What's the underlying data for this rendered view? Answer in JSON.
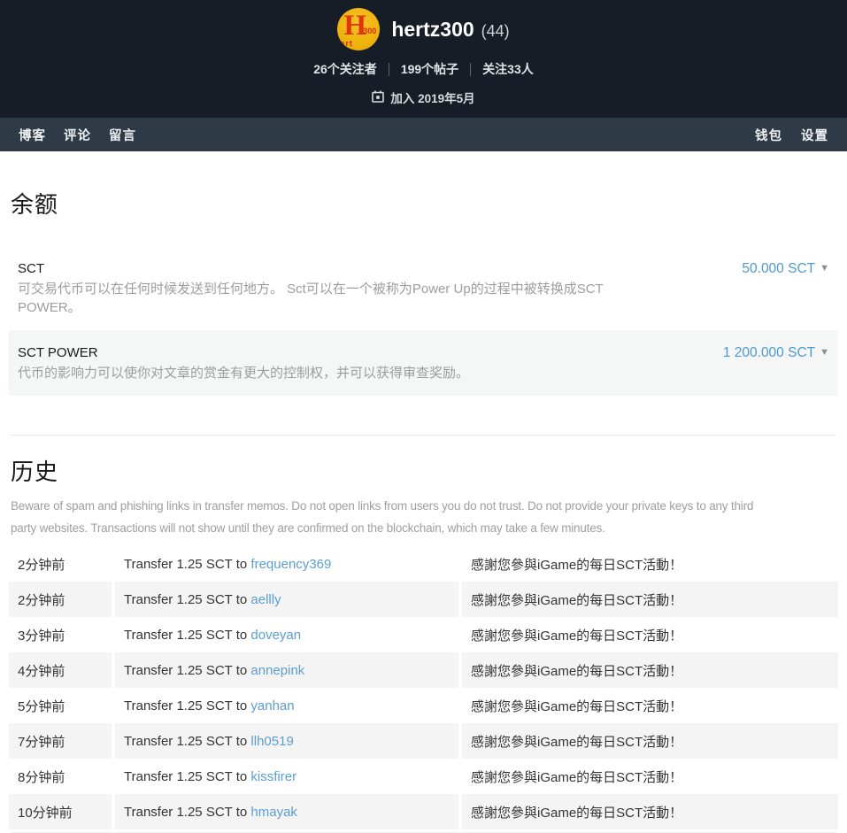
{
  "profile": {
    "username": "hertz300",
    "reputation": "(44)",
    "avatar": {
      "letter": "H",
      "number": "300",
      "sub": "ert"
    },
    "stats": [
      {
        "label": "26个关注者"
      },
      {
        "label": "199个帖子"
      },
      {
        "label": "关注33人"
      }
    ],
    "joined": "加入 2019年5月"
  },
  "nav": {
    "left": [
      {
        "label": "博客"
      },
      {
        "label": "评论"
      },
      {
        "label": "留言"
      }
    ],
    "right": [
      {
        "label": "钱包"
      },
      {
        "label": "设置"
      }
    ]
  },
  "balance": {
    "title": "余额",
    "rows": [
      {
        "label": "SCT",
        "description": "可交易代币可以在任何时候发送到任何地方。 Sct可以在一个被称为Power Up的过程中被转换成SCT POWER。",
        "amount": "50.000 SCT"
      },
      {
        "label": "SCT POWER",
        "description": "代币的影响力可以使你对文章的赏金有更大的控制权，并可以获得审查奖励。",
        "amount": "1 200.000 SCT"
      }
    ]
  },
  "history": {
    "title": "历史",
    "warning": "Beware of spam and phishing links in transfer memos. Do not open links from users you do not trust. Do not provide your private keys to any third party websites. Transactions will not show until they are confirmed on the blockchain, which may take a few minutes.",
    "transactions": [
      {
        "time": "2分钟前",
        "action": "Transfer 1.25 SCT to ",
        "recipient": "frequency369",
        "memo": "感謝您參與iGame的每日SCT活動！"
      },
      {
        "time": "2分钟前",
        "action": "Transfer 1.25 SCT to ",
        "recipient": "aellly",
        "memo": "感謝您參與iGame的每日SCT活動！"
      },
      {
        "time": "3分钟前",
        "action": "Transfer 1.25 SCT to ",
        "recipient": "doveyan",
        "memo": "感謝您參與iGame的每日SCT活動！"
      },
      {
        "time": "4分钟前",
        "action": "Transfer 1.25 SCT to ",
        "recipient": "annepink",
        "memo": "感謝您參與iGame的每日SCT活動！"
      },
      {
        "time": "5分钟前",
        "action": "Transfer 1.25 SCT to ",
        "recipient": "yanhan",
        "memo": "感謝您參與iGame的每日SCT活動！"
      },
      {
        "time": "7分钟前",
        "action": "Transfer 1.25 SCT to ",
        "recipient": "llh0519",
        "memo": "感謝您參與iGame的每日SCT活動！"
      },
      {
        "time": "8分钟前",
        "action": "Transfer 1.25 SCT to ",
        "recipient": "kissfirer",
        "memo": "感謝您參與iGame的每日SCT活動！"
      },
      {
        "time": "10分钟前",
        "action": "Transfer 1.25 SCT to ",
        "recipient": "hmayak",
        "memo": "感謝您參與iGame的每日SCT活動！"
      }
    ]
  },
  "colors": {
    "header_bg": "#171d26",
    "nav_bg": "#2e3a45",
    "accent_link": "#4b9ad4",
    "stripe_gray": "#f4f4f4",
    "avatar_gold": "#efb30d",
    "avatar_red": "#e03505"
  }
}
